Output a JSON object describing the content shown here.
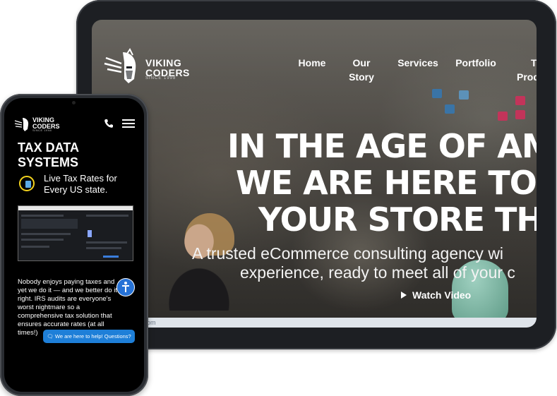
{
  "tablet": {
    "logo": {
      "line1": "VIKING",
      "line2": "CODERS",
      "since": "SINCE 1998"
    },
    "nav": [
      {
        "line1": "Home",
        "line2": ""
      },
      {
        "line1": "Our",
        "line2": "Story"
      },
      {
        "line1": "Services",
        "line2": ""
      },
      {
        "line1": "Portfolio",
        "line2": ""
      },
      {
        "line1": "T",
        "line2": "Prod"
      }
    ],
    "headline": [
      "IN THE AGE OF AM",
      "WE ARE HERE TO",
      "YOUR STORE TH"
    ],
    "subtitle": [
      "A trusted eCommerce consulting agency wi",
      "experience, ready to meet all of your c"
    ],
    "watch_label": "Watch Video",
    "url_fragment": "om"
  },
  "phone": {
    "logo": {
      "line1": "VIKING",
      "line2": "CODERS",
      "since": "SINCE 1998"
    },
    "title": [
      "TAX DATA",
      "SYSTEMS"
    ],
    "feature": [
      "Live Tax Rates for",
      "Every US state."
    ],
    "body": "Nobody enjoys paying taxes and yet we do it — and we better do it right. IRS audits are everyone's worst nightmare so a comprehensive tax solution that ensures accurate rates (at all times!)",
    "chat_label": "🗨 We are here to help! Questions?"
  },
  "colors": {
    "accent_blue": "#1e7fd8",
    "icon_yellow": "#f2d21e",
    "phone_bg": "#000000"
  },
  "icons": [
    "viking-logo-icon",
    "phone-icon",
    "menu-icon",
    "calculator-icon",
    "accessibility-icon",
    "play-icon"
  ]
}
